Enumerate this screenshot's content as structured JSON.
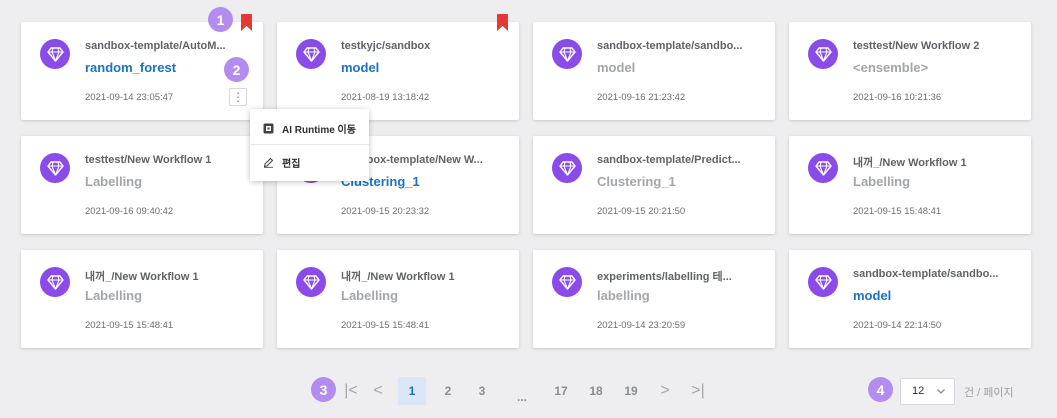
{
  "colors": {
    "accent": "#8a4be8",
    "link": "#1a73c9",
    "bookmark": "#e53935",
    "badge": "#b48cf0"
  },
  "cards": [
    {
      "path": "sandbox-template/AutoM...",
      "name": "random_forest",
      "active": true,
      "date": "2021-09-14 23:05:47",
      "bookmarked": true
    },
    {
      "path": "testkyjc/sandbox",
      "name": "model",
      "active": true,
      "date": "2021-08-19 13:18:42",
      "bookmarked": true
    },
    {
      "path": "sandbox-template/sandbo...",
      "name": "model",
      "active": false,
      "date": "2021-09-16 21:23:42",
      "bookmarked": false
    },
    {
      "path": "testtest/New Workflow 2",
      "name": "<ensemble>",
      "active": false,
      "date": "2021-09-16 10:21:36",
      "bookmarked": false
    },
    {
      "path": "testtest/New Workflow 1",
      "name": "Labelling",
      "active": false,
      "date": "2021-09-16 09:40:42",
      "bookmarked": false
    },
    {
      "path": "sandbox-template/New W...",
      "name": "Clustering_1",
      "active": true,
      "date": "2021-09-15 20:23:32",
      "bookmarked": false
    },
    {
      "path": "sandbox-template/Predict...",
      "name": "Clustering_1",
      "active": false,
      "date": "2021-09-15 20:21:50",
      "bookmarked": false
    },
    {
      "path": "내꺼_/New Workflow 1",
      "name": "Labelling",
      "active": false,
      "date": "2021-09-15 15:48:41",
      "bookmarked": false
    },
    {
      "path": "내꺼_/New Workflow 1",
      "name": "Labelling",
      "active": false,
      "date": "2021-09-15 15:48:41",
      "bookmarked": false
    },
    {
      "path": "내꺼_/New Workflow 1",
      "name": "Labelling",
      "active": false,
      "date": "2021-09-15 15:48:41",
      "bookmarked": false
    },
    {
      "path": "experiments/labelling 테...",
      "name": "labelling",
      "active": false,
      "date": "2021-09-14 23:20:59",
      "bookmarked": false
    },
    {
      "path": "sandbox-template/sandbo...",
      "name": "model",
      "active": true,
      "date": "2021-09-14 22:14:50",
      "bookmarked": false
    }
  ],
  "more_icon": "⋮",
  "context_menu": {
    "items": [
      {
        "label": "AI Runtime 이동",
        "icon": "runtime-icon"
      },
      {
        "label": "편집",
        "icon": "pencil-icon"
      }
    ]
  },
  "badges": [
    "1",
    "2",
    "3",
    "4"
  ],
  "pagination": {
    "first": "|<",
    "prev": "<",
    "next": ">",
    "last": ">|",
    "pages": [
      "1",
      "2",
      "3",
      "...",
      "17",
      "18",
      "19"
    ],
    "current": "1"
  },
  "page_size": {
    "value": "12",
    "label": "건 / 페이지"
  }
}
